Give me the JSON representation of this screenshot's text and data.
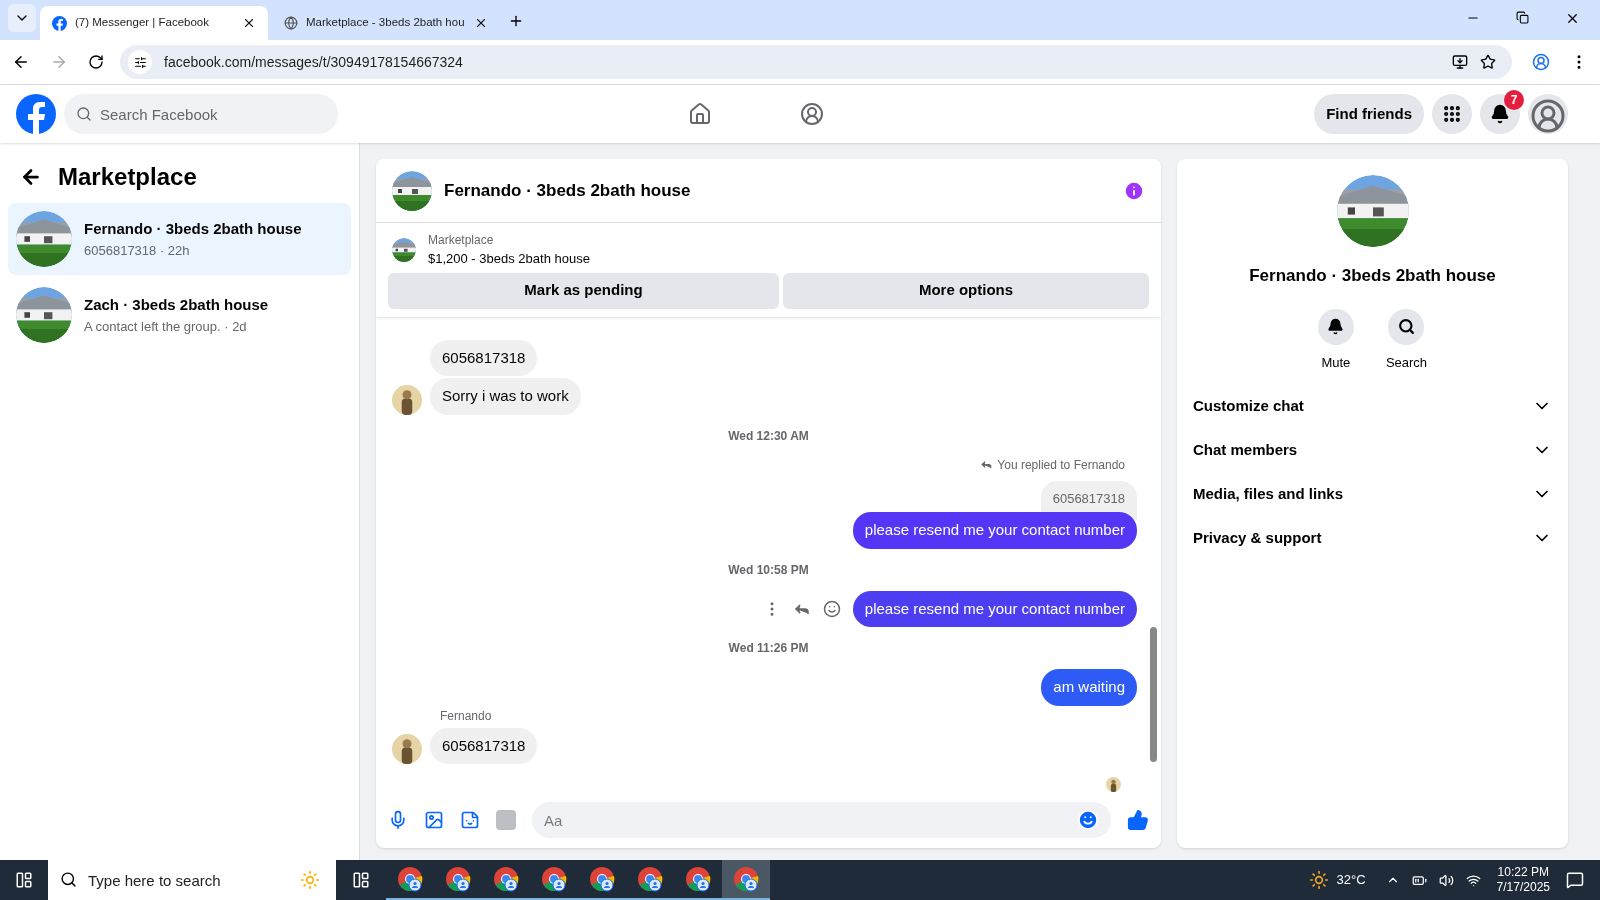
{
  "browser": {
    "tabs": [
      {
        "title": "(7) Messenger | Facebook",
        "kind": "facebook",
        "selected": true
      },
      {
        "title": "Marketplace - 3beds 2bath hou",
        "kind": "globe",
        "selected": false
      }
    ],
    "url": "facebook.com/messages/t/30949178154667324"
  },
  "header": {
    "search_placeholder": "Search Facebook",
    "find_friends": "Find friends",
    "notification_count": "7"
  },
  "sidebar": {
    "title": "Marketplace",
    "threads": [
      {
        "name": "Fernando · 3beds 2bath house",
        "preview": "6056817318 · 22h",
        "selected": true
      },
      {
        "name": "Zach · 3beds 2bath house",
        "preview": "A contact left the group. · 2d",
        "selected": false
      }
    ]
  },
  "chat": {
    "title": "Fernando · 3beds 2bath house",
    "listing": {
      "source": "Marketplace",
      "title": "$1,200 - 3beds 2bath house"
    },
    "actions": [
      "Mark as pending",
      "More options"
    ],
    "messages": [
      {
        "kind": "incoming",
        "text": "6056817318",
        "avatar": false
      },
      {
        "kind": "incoming",
        "text": "Sorry i was to work",
        "avatar": true
      },
      {
        "kind": "timestamp",
        "text": "Wed 12:30 AM"
      },
      {
        "kind": "outgoing",
        "text": "please resend me your contact number",
        "color": "#5536f6",
        "reply_note": "You replied to Fernando",
        "quoted": "6056817318",
        "hover_actions": false
      },
      {
        "kind": "timestamp",
        "text": "Wed 10:58 PM"
      },
      {
        "kind": "outgoing",
        "text": "please resend me your contact number",
        "color": "#4d3ef2",
        "hover_actions": true
      },
      {
        "kind": "timestamp",
        "text": "Wed 11:26 PM"
      },
      {
        "kind": "outgoing",
        "text": "am waiting",
        "color": "#2e5af5",
        "hover_actions": false
      },
      {
        "kind": "incoming",
        "text": "6056817318",
        "avatar": true,
        "sender": "Fernando"
      },
      {
        "kind": "seen"
      }
    ],
    "composer_placeholder": "Aa"
  },
  "details": {
    "title": "Fernando · 3beds 2bath house",
    "buttons": [
      {
        "label": "Mute",
        "kind": "bell"
      },
      {
        "label": "Search",
        "kind": "search"
      }
    ],
    "sections": [
      {
        "label": "Customize chat",
        "expanded": false
      },
      {
        "label": "Chat members",
        "expanded": false
      },
      {
        "label": "Media, files and links",
        "expanded": false
      },
      {
        "label": "Privacy & support",
        "expanded": false
      }
    ]
  },
  "taskbar": {
    "search_placeholder": "Type here to search",
    "apps": [
      {
        "selected": false
      },
      {
        "selected": false
      },
      {
        "selected": false
      },
      {
        "selected": false
      },
      {
        "selected": false
      },
      {
        "selected": false
      },
      {
        "selected": false
      },
      {
        "selected": true
      }
    ],
    "temperature": "32°C",
    "time": "10:22 PM",
    "date": "7/17/2025"
  }
}
